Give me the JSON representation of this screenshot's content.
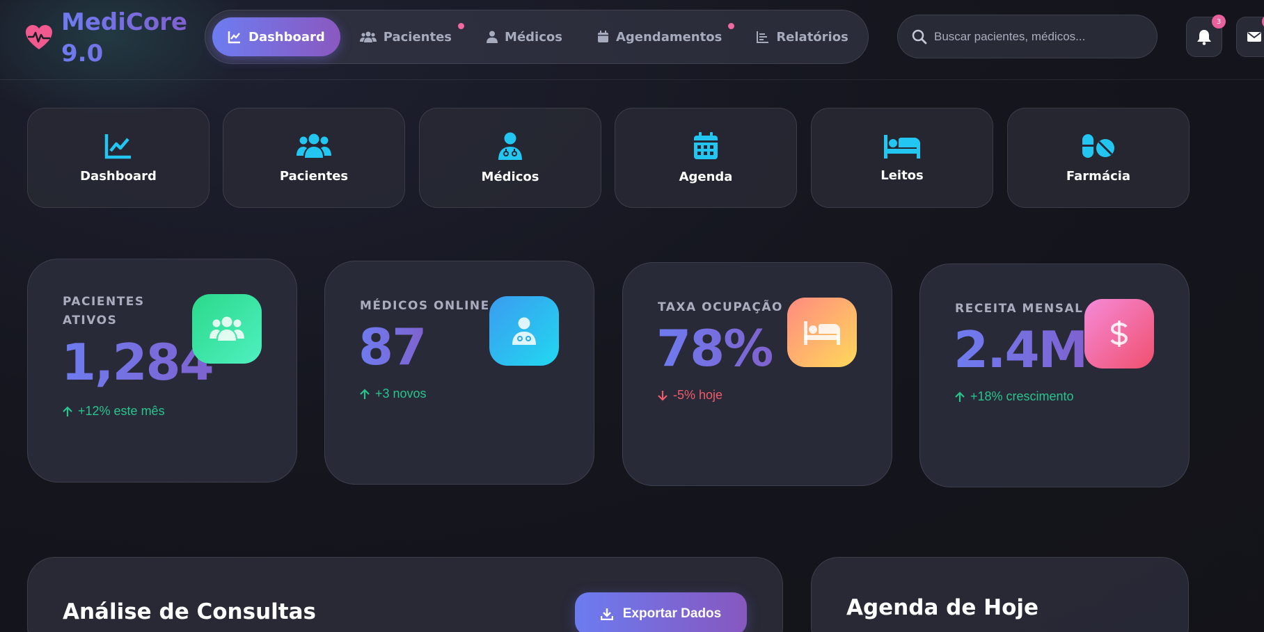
{
  "app": {
    "name_line1": "MediCore",
    "name_line2": "9.0"
  },
  "nav": {
    "items": [
      {
        "label": "Dashboard",
        "icon": "chart-line-icon",
        "active": true,
        "dot": false
      },
      {
        "label": "Pacientes",
        "icon": "users-icon",
        "active": false,
        "dot": true
      },
      {
        "label": "Médicos",
        "icon": "user-doctor-icon",
        "active": false,
        "dot": false
      },
      {
        "label": "Agendamentos",
        "icon": "calendar-icon",
        "active": false,
        "dot": true
      },
      {
        "label": "Relatórios",
        "icon": "bar-chart-icon",
        "active": false,
        "dot": false
      }
    ]
  },
  "search": {
    "placeholder": "Buscar pacientes, médicos..."
  },
  "header_actions": {
    "notifications_icon": "bell-icon",
    "notifications_badge": "3",
    "messages_icon": "envelope-icon"
  },
  "quick_tiles": [
    {
      "label": "Dashboard",
      "icon": "chart-line-icon"
    },
    {
      "label": "Pacientes",
      "icon": "users-icon"
    },
    {
      "label": "Médicos",
      "icon": "user-doctor-icon"
    },
    {
      "label": "Agenda",
      "icon": "calendar-icon"
    },
    {
      "label": "Leitos",
      "icon": "bed-icon"
    },
    {
      "label": "Farmácia",
      "icon": "pills-icon"
    }
  ],
  "stats": [
    {
      "label_line1": "PACIENTES",
      "label_line2": "ATIVOS",
      "value": "1,284",
      "trend": "+12% este mês",
      "direction": "up",
      "icon": "users-icon",
      "color": "#3ee59b"
    },
    {
      "label_line1": "MÉDICOS ONLINE",
      "label_line2": "",
      "value": "87",
      "trend": "+3 novos",
      "direction": "up",
      "icon": "user-doctor-icon",
      "color": "#22c6f0"
    },
    {
      "label_line1": "TAXA OCUPAÇÃO",
      "label_line2": "",
      "value": "78%",
      "trend": "-5% hoje",
      "direction": "down",
      "icon": "bed-icon",
      "color": "#ff9a76"
    },
    {
      "label_line1": "RECEITA MENSAL",
      "label_line2": "",
      "value": "2.4M",
      "trend": "+18% crescimento",
      "direction": "up",
      "icon": "dollar-icon",
      "color": "#f06d9a"
    }
  ],
  "panels": {
    "consultas_title": "Análise de Consultas",
    "export_label": "Exportar Dados",
    "agenda_title": "Agenda de Hoje"
  },
  "colors": {
    "accent": "#6e7cf0",
    "accent2": "#8a58c0",
    "cyan": "#22c6f0",
    "up": "#28c48e",
    "down": "#ef5b6a",
    "heart": "#f05a8e"
  }
}
